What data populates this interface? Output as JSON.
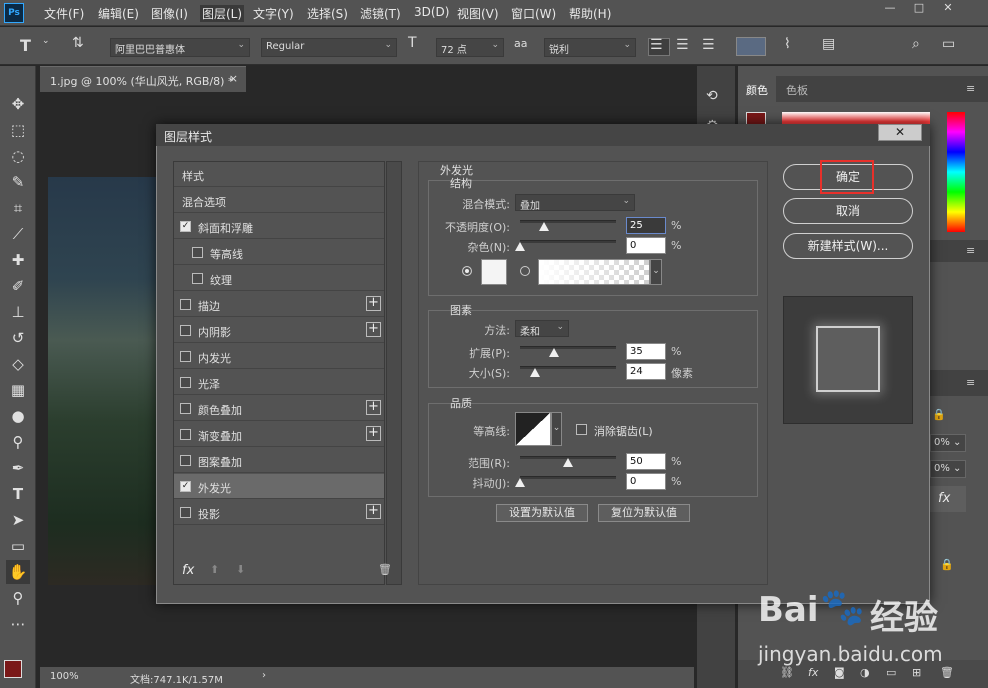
{
  "app": {
    "logo": "Ps"
  },
  "menu": [
    "文件(F)",
    "编辑(E)",
    "图像(I)",
    "图层(L)",
    "文字(Y)",
    "选择(S)",
    "滤镜(T)",
    "3D(D)",
    "视图(V)",
    "窗口(W)",
    "帮助(H)"
  ],
  "window_controls": [
    "—",
    "□",
    "✕"
  ],
  "options": {
    "font_family": "阿里巴巴普惠体",
    "font_style": "Regular",
    "font_size": "72 点",
    "aa_icon": "aa",
    "antialias": "锐利"
  },
  "document": {
    "tab_title": "1.jpg @ 100% (华山风光, RGB/8) *",
    "close": "×"
  },
  "status": {
    "zoom": "100%",
    "doc_info": "文档:747.1K/1.57M",
    "arrow": "›"
  },
  "right_panel": {
    "tabs": [
      "颜色",
      "色板"
    ],
    "pct1": "0%",
    "pct2": "0%",
    "fx": "fx"
  },
  "dialog": {
    "title": "图层样式",
    "close": "✕",
    "style_list": [
      {
        "label": "样式",
        "checkbox": null,
        "plus": false
      },
      {
        "label": "混合选项",
        "checkbox": null,
        "plus": false
      },
      {
        "label": "斜面和浮雕",
        "checkbox": true,
        "plus": false
      },
      {
        "label": "等高线",
        "checkbox": false,
        "plus": false,
        "indent": true
      },
      {
        "label": "纹理",
        "checkbox": false,
        "plus": false,
        "indent": true
      },
      {
        "label": "描边",
        "checkbox": false,
        "plus": true
      },
      {
        "label": "内阴影",
        "checkbox": false,
        "plus": true
      },
      {
        "label": "内发光",
        "checkbox": false,
        "plus": false
      },
      {
        "label": "光泽",
        "checkbox": false,
        "plus": false
      },
      {
        "label": "颜色叠加",
        "checkbox": false,
        "plus": true
      },
      {
        "label": "渐变叠加",
        "checkbox": false,
        "plus": true
      },
      {
        "label": "图案叠加",
        "checkbox": false,
        "plus": false
      },
      {
        "label": "外发光",
        "checkbox": true,
        "plus": false,
        "active": true
      },
      {
        "label": "投影",
        "checkbox": false,
        "plus": true
      }
    ],
    "footer_fx": "fx",
    "section_title": "外发光",
    "structure": {
      "label": "结构",
      "blend_mode_label": "混合模式:",
      "blend_mode": "叠加",
      "opacity_label": "不透明度(O):",
      "opacity": "25",
      "noise_label": "杂色(N):",
      "noise": "0",
      "unit": "%"
    },
    "elements": {
      "label": "图素",
      "method_label": "方法:",
      "method": "柔和",
      "spread_label": "扩展(P):",
      "spread": "35",
      "size_label": "大小(S):",
      "size": "24",
      "size_unit": "像素",
      "unit": "%"
    },
    "quality": {
      "label": "品质",
      "contour_label": "等高线:",
      "antialias_label": "消除锯齿(L)",
      "range_label": "范围(R):",
      "range": "50",
      "jitter_label": "抖动(J):",
      "jitter": "0",
      "unit": "%"
    },
    "set_default": "设置为默认值",
    "reset_default": "复位为默认值",
    "ok": "确定",
    "cancel": "取消",
    "new_style": "新建样式(W)..."
  },
  "watermark": {
    "brand": "Bai",
    "brand2": "经验",
    "url": "jingyan.baidu.com"
  }
}
